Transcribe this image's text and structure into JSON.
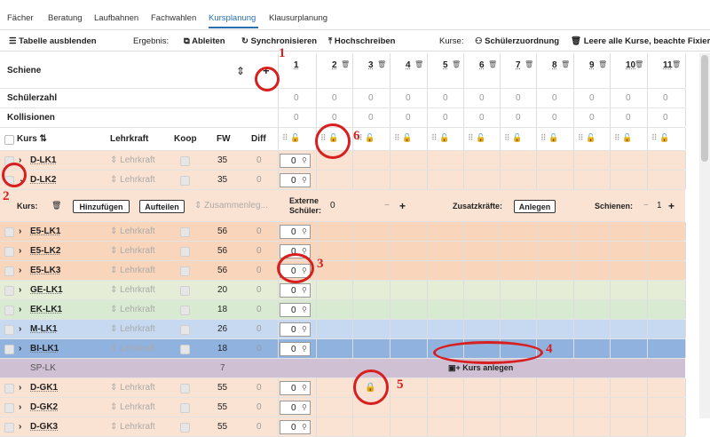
{
  "tabs": [
    {
      "label": "Fächer"
    },
    {
      "label": "Beratung"
    },
    {
      "label": "Laufbahnen"
    },
    {
      "label": "Fachwahlen"
    },
    {
      "label": "Kursplanung"
    },
    {
      "label": "Klausurplanung"
    }
  ],
  "toolbar": {
    "hide_table": "Tabelle ausblenden",
    "result_label": "Ergebnis:",
    "derive": "Ableiten",
    "sync": "Synchronisieren",
    "writeup": "Hochschreiben",
    "courses_label": "Kurse:",
    "student_assign": "Schülerzuordnung",
    "clear_courses": "Leere alle Kurse, beachte Fixierungen"
  },
  "header": {
    "schiene": "Schiene",
    "schuelerzahl": "Schülerzahl",
    "kollisionen": "Kollisionen",
    "kurs": "Kurs",
    "lehrkraft": "Lehrkraft",
    "koop": "Koop",
    "fw": "FW",
    "diff": "Diff",
    "add_symbol": "+"
  },
  "schienen": [
    "1",
    "2",
    "3",
    "4",
    "5",
    "6",
    "7",
    "8",
    "9",
    "10",
    "11"
  ],
  "zero": "0",
  "expand": {
    "kurs_label": "Kurs:",
    "add": "Hinzufügen",
    "split": "Aufteilen",
    "merge": "Zusammenleg...",
    "ext_label": "Externe Schüler:",
    "ext_value": "0",
    "extra_label": "Zusatzkräfte:",
    "create": "Anlegen",
    "rails_label": "Schienen:",
    "rails_value": "1",
    "minus": "−",
    "plus": "+"
  },
  "teacher_placeholder": "Lehrkraft",
  "rows": [
    {
      "name": "D-LK1",
      "fw": "35",
      "diff": "0",
      "bg": "#fbe3d3"
    },
    {
      "name": "D-LK2",
      "fw": "35",
      "diff": "0",
      "bg": "#fbe3d3"
    },
    {
      "name": "E5-LK1",
      "fw": "56",
      "diff": "0",
      "bg": "#f8d5bb"
    },
    {
      "name": "E5-LK2",
      "fw": "56",
      "diff": "0",
      "bg": "#f8d5bb"
    },
    {
      "name": "E5-LK3",
      "fw": "56",
      "diff": "0",
      "bg": "#f8d5bb"
    },
    {
      "name": "GE-LK1",
      "fw": "20",
      "diff": "0",
      "bg": "#e5edd6"
    },
    {
      "name": "EK-LK1",
      "fw": "18",
      "diff": "0",
      "bg": "#d8ead2"
    },
    {
      "name": "M-LK1",
      "fw": "26",
      "diff": "0",
      "bg": "#c6d9f0"
    },
    {
      "name": "BI-LK1",
      "fw": "18",
      "diff": "0",
      "bg": "#8fb2df"
    }
  ],
  "sp_row": {
    "name": "SP-LK",
    "fw": "7",
    "button": "Kurs anlegen",
    "bg": "#cfc0d3"
  },
  "rows2": [
    {
      "name": "D-GK1",
      "fw": "55",
      "diff": "0",
      "bg": "#fbe3d3"
    },
    {
      "name": "D-GK2",
      "fw": "55",
      "diff": "0",
      "bg": "#fbe3d3"
    },
    {
      "name": "D-GK3",
      "fw": "55",
      "diff": "0",
      "bg": "#fbe3d3"
    }
  ],
  "annotations": [
    "1",
    "2",
    "3",
    "4",
    "5",
    "6"
  ],
  "icons": {
    "up": "chevron-up",
    "down": "chevron-down",
    "pin": "pin",
    "lock": "lock",
    "trash": "trash"
  }
}
